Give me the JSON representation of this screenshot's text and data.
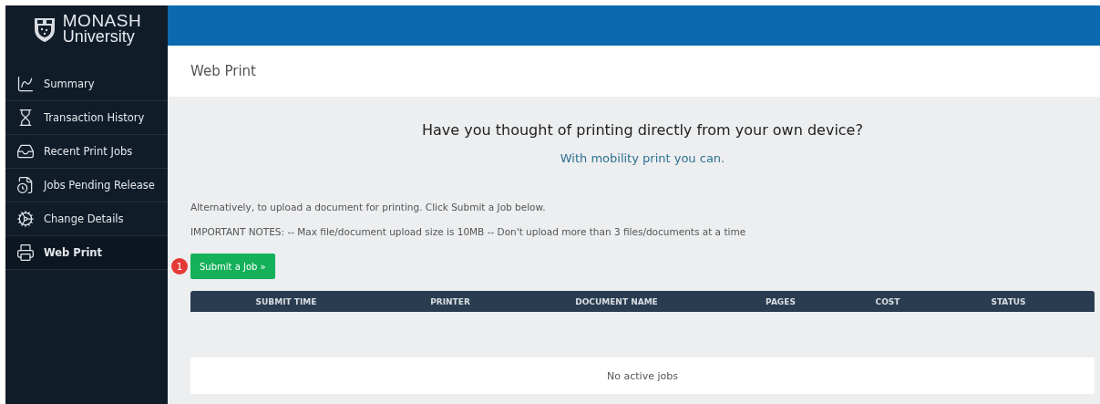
{
  "logo": {
    "line1": "MONASH",
    "line2": "University"
  },
  "sidebar": {
    "items": [
      {
        "label": "Summary",
        "kind": "chart",
        "selected": false
      },
      {
        "label": "Transaction History",
        "kind": "hourglass",
        "selected": false
      },
      {
        "label": "Recent Print Jobs",
        "kind": "inbox",
        "selected": false
      },
      {
        "label": "Jobs Pending Release",
        "kind": "pending",
        "selected": false
      },
      {
        "label": "Change Details",
        "kind": "cog",
        "selected": false
      },
      {
        "label": "Web Print",
        "kind": "printer",
        "selected": true
      }
    ]
  },
  "page_title": "Web Print",
  "promo": {
    "heading": "Have you thought of printing directly from your own device?",
    "link": "With mobility print you can."
  },
  "intro": "Alternatively, to upload a document for printing. Click Submit a Job below.",
  "notes": "IMPORTANT NOTES: -- Max file/document upload size is 10MB -- Don't upload more than 3 files/documents at a time",
  "step_badge": "1",
  "submit_button": "Submit a Job »",
  "table": {
    "columns": [
      "SUBMIT TIME",
      "PRINTER",
      "DOCUMENT NAME",
      "PAGES",
      "COST",
      "STATUS"
    ],
    "empty_message": "No active jobs"
  }
}
